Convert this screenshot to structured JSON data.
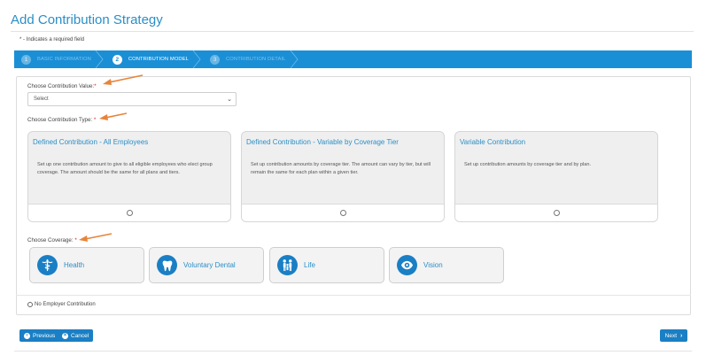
{
  "page": {
    "title": "Add Contribution Strategy",
    "required_note": "* - Indicates a required field"
  },
  "stepper": {
    "steps": [
      {
        "number": "1",
        "label": "BASIC INFORMATION",
        "state": "inactive"
      },
      {
        "number": "2",
        "label": "CONTRIBUTION MODEL",
        "state": "active"
      },
      {
        "number": "3",
        "label": "CONTRIBUTION DETAIL",
        "state": "inactive"
      }
    ]
  },
  "contribution_value": {
    "label": "Choose Contribution Value:",
    "required_mark": "*",
    "selected": "Select"
  },
  "contribution_type": {
    "label": "Choose Contribution Type:",
    "required_mark": "*",
    "options": [
      {
        "title": "Defined Contribution - All Employees",
        "description": "Set up one contribution amount to give to all eligible employees who elect group coverage. The amount should be the same for all plans and tiers."
      },
      {
        "title": "Defined Contribution - Variable by Coverage Tier",
        "description": "Set up contribution amounts by coverage tier. The amount can vary by tier, but will remain the same for each plan within a given tier."
      },
      {
        "title": "Variable Contribution",
        "description": "Set up contribution amounts by coverage tier and by plan."
      }
    ]
  },
  "coverage": {
    "label": "Choose Coverage:",
    "required_mark": "*",
    "options": [
      {
        "label": "Health",
        "icon": "caduceus-icon"
      },
      {
        "label": "Voluntary Dental",
        "icon": "tooth-icon"
      },
      {
        "label": "Life",
        "icon": "family-icon"
      },
      {
        "label": "Vision",
        "icon": "eye-icon"
      }
    ]
  },
  "no_employer": {
    "label": "No Employer Contribution"
  },
  "buttons": {
    "previous": "Previous",
    "cancel": "Cancel",
    "next": "Next"
  },
  "colors": {
    "accent": "#1a8fd6",
    "button": "#1a7fc4",
    "title": "#2a8fc7",
    "annotation_arrow": "#e8843a"
  }
}
